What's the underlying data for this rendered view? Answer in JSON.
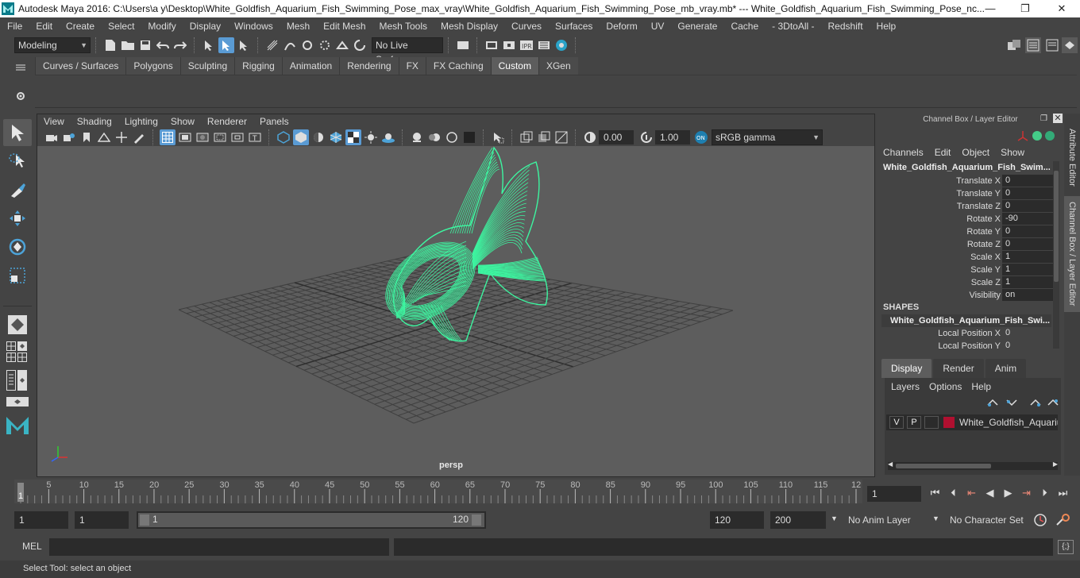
{
  "titlebar": {
    "title": "Autodesk Maya 2016: C:\\Users\\a y\\Desktop\\White_Goldfish_Aquarium_Fish_Swimming_Pose_max_vray\\White_Goldfish_Aquarium_Fish_Swimming_Pose_mb_vray.mb*   ---   White_Goldfish_Aquarium_Fish_Swimming_Pose_nc...",
    "minimize": "—",
    "maximize": "❐",
    "close": "✕"
  },
  "menubar": [
    "File",
    "Edit",
    "Create",
    "Select",
    "Modify",
    "Display",
    "Windows",
    "Mesh",
    "Edit Mesh",
    "Mesh Tools",
    "Mesh Display",
    "Curves",
    "Surfaces",
    "Deform",
    "UV",
    "Generate",
    "Cache",
    "- 3DtoAll -",
    "Redshift",
    "Help"
  ],
  "statusline": {
    "mode": "Modeling",
    "live_surface": "No Live Surface"
  },
  "shelf": {
    "tabs": [
      "Curves / Surfaces",
      "Polygons",
      "Sculpting",
      "Rigging",
      "Animation",
      "Rendering",
      "FX",
      "FX Caching",
      "Custom",
      "XGen"
    ],
    "active_tab": "Custom"
  },
  "viewport": {
    "menu": [
      "View",
      "Shading",
      "Lighting",
      "Show",
      "Renderer",
      "Panels"
    ],
    "exposure": "0.00",
    "gamma": "1.00",
    "color_space": "sRGB gamma",
    "camera_label": "persp",
    "wire_color": "#3df5a0"
  },
  "channelbox": {
    "title": "Channel Box / Layer Editor",
    "menu": [
      "Channels",
      "Edit",
      "Object",
      "Show"
    ],
    "object_name": "White_Goldfish_Aquarium_Fish_Swim...",
    "attributes": [
      {
        "label": "Translate X",
        "value": "0"
      },
      {
        "label": "Translate Y",
        "value": "0"
      },
      {
        "label": "Translate Z",
        "value": "0"
      },
      {
        "label": "Rotate X",
        "value": "-90"
      },
      {
        "label": "Rotate Y",
        "value": "0"
      },
      {
        "label": "Rotate Z",
        "value": "0"
      },
      {
        "label": "Scale X",
        "value": "1"
      },
      {
        "label": "Scale Y",
        "value": "1"
      },
      {
        "label": "Scale Z",
        "value": "1"
      },
      {
        "label": "Visibility",
        "value": "on"
      }
    ],
    "shapes_header": "SHAPES",
    "shape_name": "White_Goldfish_Aquarium_Fish_Swi...",
    "shape_attributes": [
      {
        "label": "Local Position X",
        "value": "0"
      },
      {
        "label": "Local Position Y",
        "value": "0"
      }
    ]
  },
  "side_tabs": [
    "Attribute Editor",
    "Channel Box / Layer Editor"
  ],
  "layer_editor": {
    "tabs": [
      "Display",
      "Render",
      "Anim"
    ],
    "active_tab": "Display",
    "menu": [
      "Layers",
      "Options",
      "Help"
    ],
    "layer": {
      "v": "V",
      "p": "P",
      "name": "White_Goldfish_Aquariu",
      "color": "#b01030"
    }
  },
  "timeline": {
    "ticks": [
      "5",
      "10",
      "15",
      "20",
      "25",
      "30",
      "35",
      "40",
      "45",
      "50",
      "55",
      "60",
      "65",
      "70",
      "75",
      "80",
      "85",
      "90",
      "95",
      "100",
      "105",
      "110",
      "115",
      "12"
    ],
    "current_frame_marker": "1",
    "current_frame": "1"
  },
  "range": {
    "start_field": "1",
    "start_field2": "1",
    "range_start": "1",
    "range_end": "120",
    "end_field": "120",
    "end_field2": "200",
    "anim_layer": "No Anim Layer",
    "character_set": "No Character Set"
  },
  "command_line": {
    "label": "MEL"
  },
  "help_line": "Select Tool: select an object"
}
